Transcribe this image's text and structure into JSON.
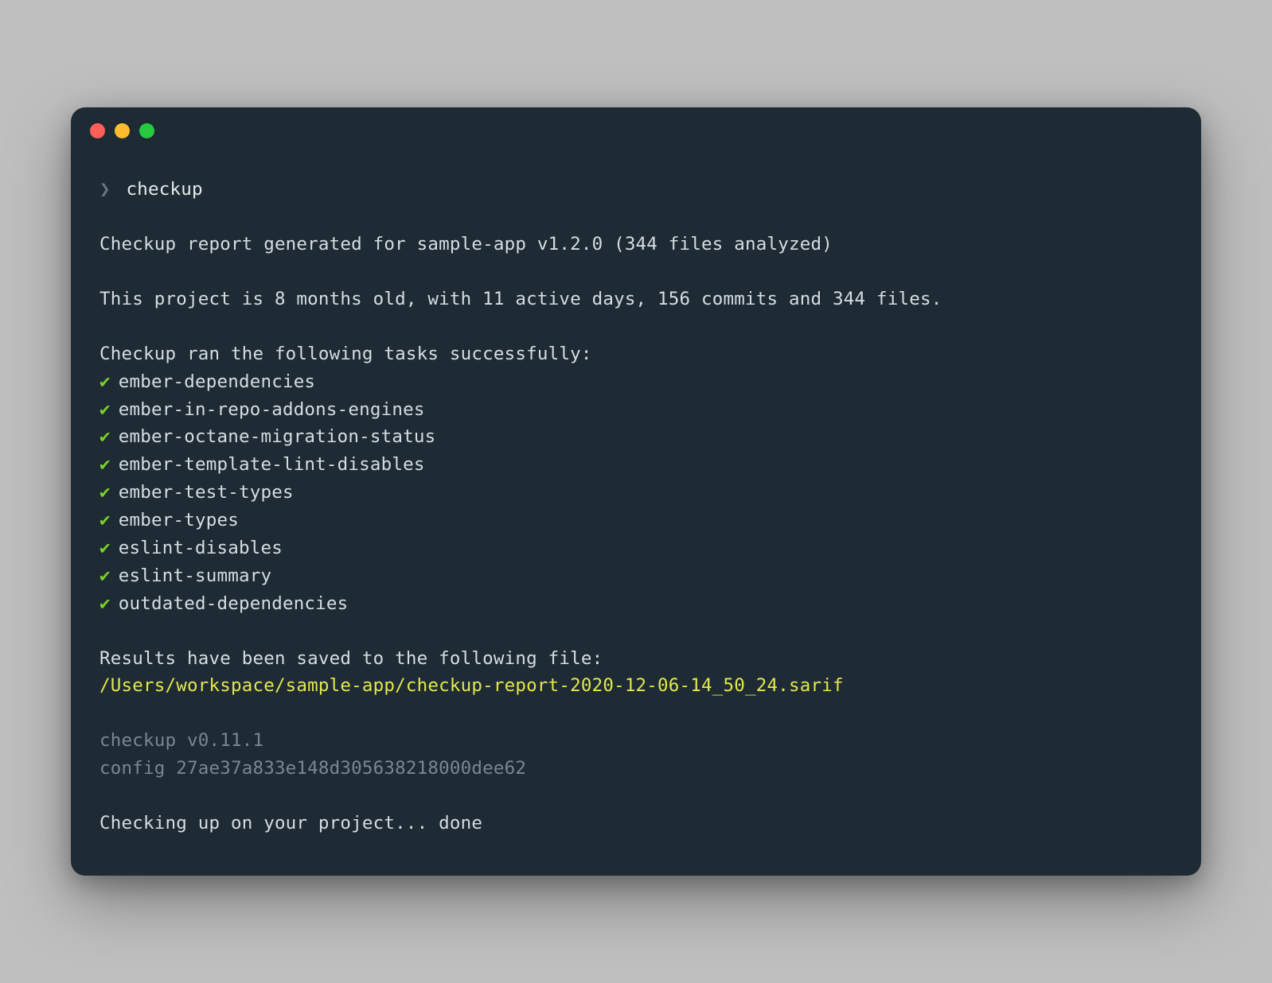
{
  "prompt": {
    "chevron": "❯",
    "command": "checkup"
  },
  "report": {
    "header": "Checkup report generated for sample-app v1.2.0 (344 files analyzed)",
    "summary": "This project is 8 months old, with 11 active days, 156 commits and 344 files."
  },
  "tasks": {
    "intro": "Checkup ran the following tasks successfully:",
    "check_glyph": "✔",
    "items": [
      "ember-dependencies",
      "ember-in-repo-addons-engines",
      "ember-octane-migration-status",
      "ember-template-lint-disables",
      "ember-test-types",
      "ember-types",
      "eslint-disables",
      "eslint-summary",
      "outdated-dependencies"
    ]
  },
  "results": {
    "intro": "Results have been saved to the following file:",
    "path": "/Users/workspace/sample-app/checkup-report-2020-12-06-14_50_24.sarif"
  },
  "footer": {
    "version": "checkup v0.11.1",
    "config": "config 27ae37a833e148d305638218000dee62"
  },
  "status": "Checking up on your project... done"
}
